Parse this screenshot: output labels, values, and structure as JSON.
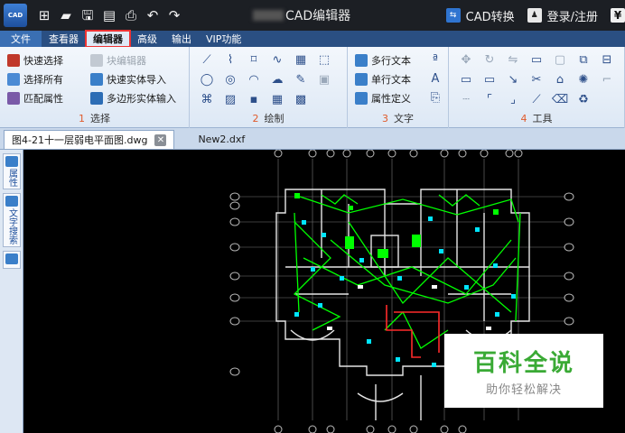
{
  "titlebar": {
    "app_title": "CAD编辑器",
    "cad_convert": "CAD转换",
    "login": "登录/注册",
    "price_icon": "¥",
    "cad_logo_text": "CAD"
  },
  "menus": [
    "文件",
    "查看器",
    "编辑器",
    "高级",
    "输出",
    "VIP功能"
  ],
  "ribbon": {
    "select_group": {
      "label": "选择",
      "number": "1",
      "buttons": [
        "快速选择",
        "选择所有",
        "匹配属性",
        "块编辑器",
        "快速实体导入",
        "多边形实体输入"
      ]
    },
    "draw_group": {
      "label": "绘制",
      "number": "2"
    },
    "text_group": {
      "label": "文字",
      "number": "3",
      "buttons": [
        "多行文本",
        "单行文本",
        "属性定义"
      ]
    },
    "tools_group": {
      "label": "工具",
      "number": "4"
    }
  },
  "doctabs": [
    "图4-21十一层弱电平面图.dwg",
    "New2.dxf"
  ],
  "leftpanel": {
    "tab1": "属性",
    "tab2": "文字搜索"
  },
  "watermark": {
    "title": "百科全说",
    "subtitle": "助你轻松解决"
  },
  "colors": {
    "menubar": "#2a4f82",
    "accent_red": "#e33333",
    "cad_green": "#00ff00",
    "cad_cyan": "#00e5ff",
    "watermark_green": "#3aaa35"
  }
}
